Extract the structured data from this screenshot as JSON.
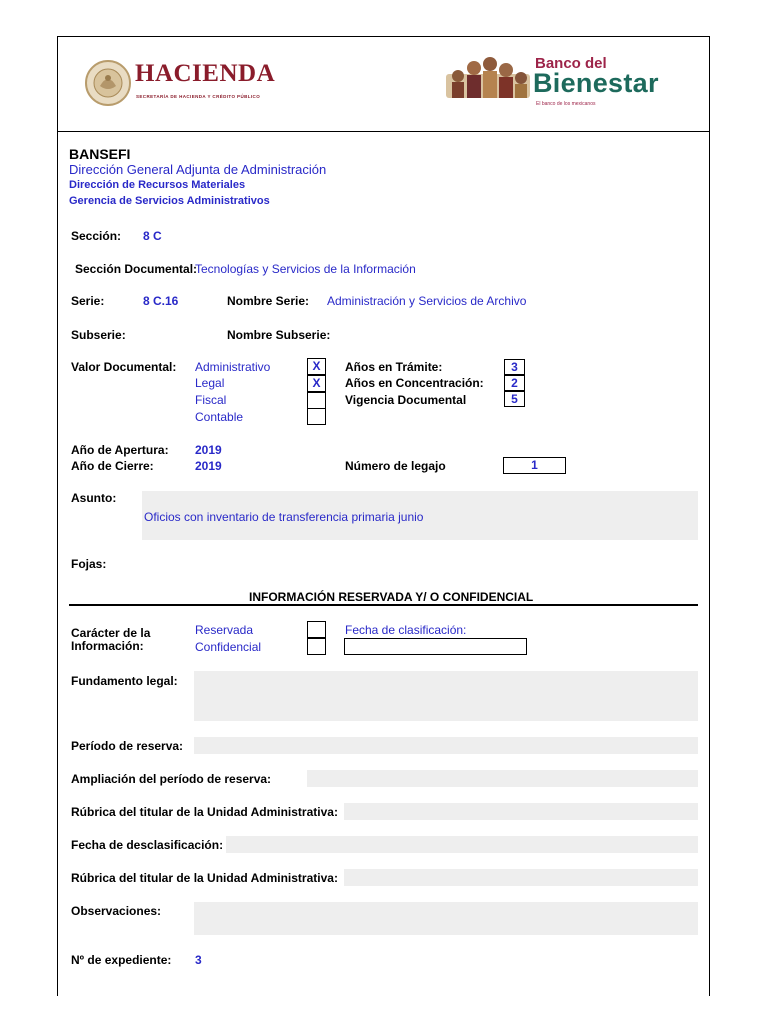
{
  "header": {
    "hacienda_title": "HACIENDA",
    "hacienda_subtitle": "SECRETARÍA DE HACIENDA Y CRÉDITO PÚBLICO",
    "bienestar_small": "Banco del",
    "bienestar_big": "Bienestar",
    "bienestar_tag": "El banco de los mexicanos"
  },
  "org": {
    "name": "BANSEFI",
    "direccion_general": "Dirección General Adjunta de Administración",
    "direccion": "Dirección de Recursos Materiales",
    "gerencia": "Gerencia de Servicios Administrativos"
  },
  "seccion": {
    "label": "Sección:",
    "value": "8 C"
  },
  "seccion_documental": {
    "label": "Sección Documental:",
    "value": "Tecnologías y Servicios de la Información"
  },
  "serie": {
    "label": "Serie:",
    "value": "8 C.16",
    "nombre_label": "Nombre Serie:",
    "nombre_value": "Administración y Servicios de Archivo"
  },
  "subserie": {
    "label": "Subserie:",
    "nombre_label": "Nombre Subserie:"
  },
  "valor_documental": {
    "label": "Valor Documental:",
    "options": [
      {
        "label": "Administrativo",
        "mark": "X"
      },
      {
        "label": "Legal",
        "mark": "X"
      },
      {
        "label": "Fiscal",
        "mark": ""
      },
      {
        "label": "Contable",
        "mark": ""
      }
    ],
    "tramite_label": "Años en Trámite:",
    "tramite_value": "3",
    "concentracion_label": "Años en Concentración:",
    "concentracion_value": "2",
    "vigencia_label": "Vigencia Documental",
    "vigencia_value": "5"
  },
  "fechas": {
    "apertura_label": "Año de Apertura:",
    "apertura_value": "2019",
    "cierre_label": "Año de Cierre:",
    "cierre_value": "2019",
    "legajo_label": "Número de legajo",
    "legajo_value": "1"
  },
  "asunto": {
    "label": "Asunto:",
    "value": "Oficios con inventario de transferencia primaria junio"
  },
  "fojas": {
    "label": "Fojas:"
  },
  "reservada_section": {
    "title": "INFORMACIÓN RESERVADA Y/ O CONFIDENCIAL",
    "caracter_label_1": "Carácter de la",
    "caracter_label_2": "Información:",
    "reservada": "Reservada",
    "confidencial": "Confidencial",
    "fecha_clasificacion_label": "Fecha de clasificación:",
    "fundamento_label": "Fundamento legal:",
    "periodo_label": "Período de reserva:",
    "ampliacion_label": "Ampliación del período de reserva:",
    "rubrica1_label": "Rúbrica del titular de la Unidad Administrativa:",
    "desclasificacion_label": "Fecha de desclasificación:",
    "rubrica2_label": "Rúbrica del titular de la Unidad Administrativa:",
    "observaciones_label": "Observaciones:",
    "expediente_label": "Nº de expediente:",
    "expediente_value": "3"
  },
  "colors": {
    "blue_text": "#2929c8",
    "hacienda": "#8a1c2b",
    "bienestar_green": "#1d6a5c",
    "bienestar_red": "#9d2449",
    "field_gray": "#eeeeee"
  }
}
